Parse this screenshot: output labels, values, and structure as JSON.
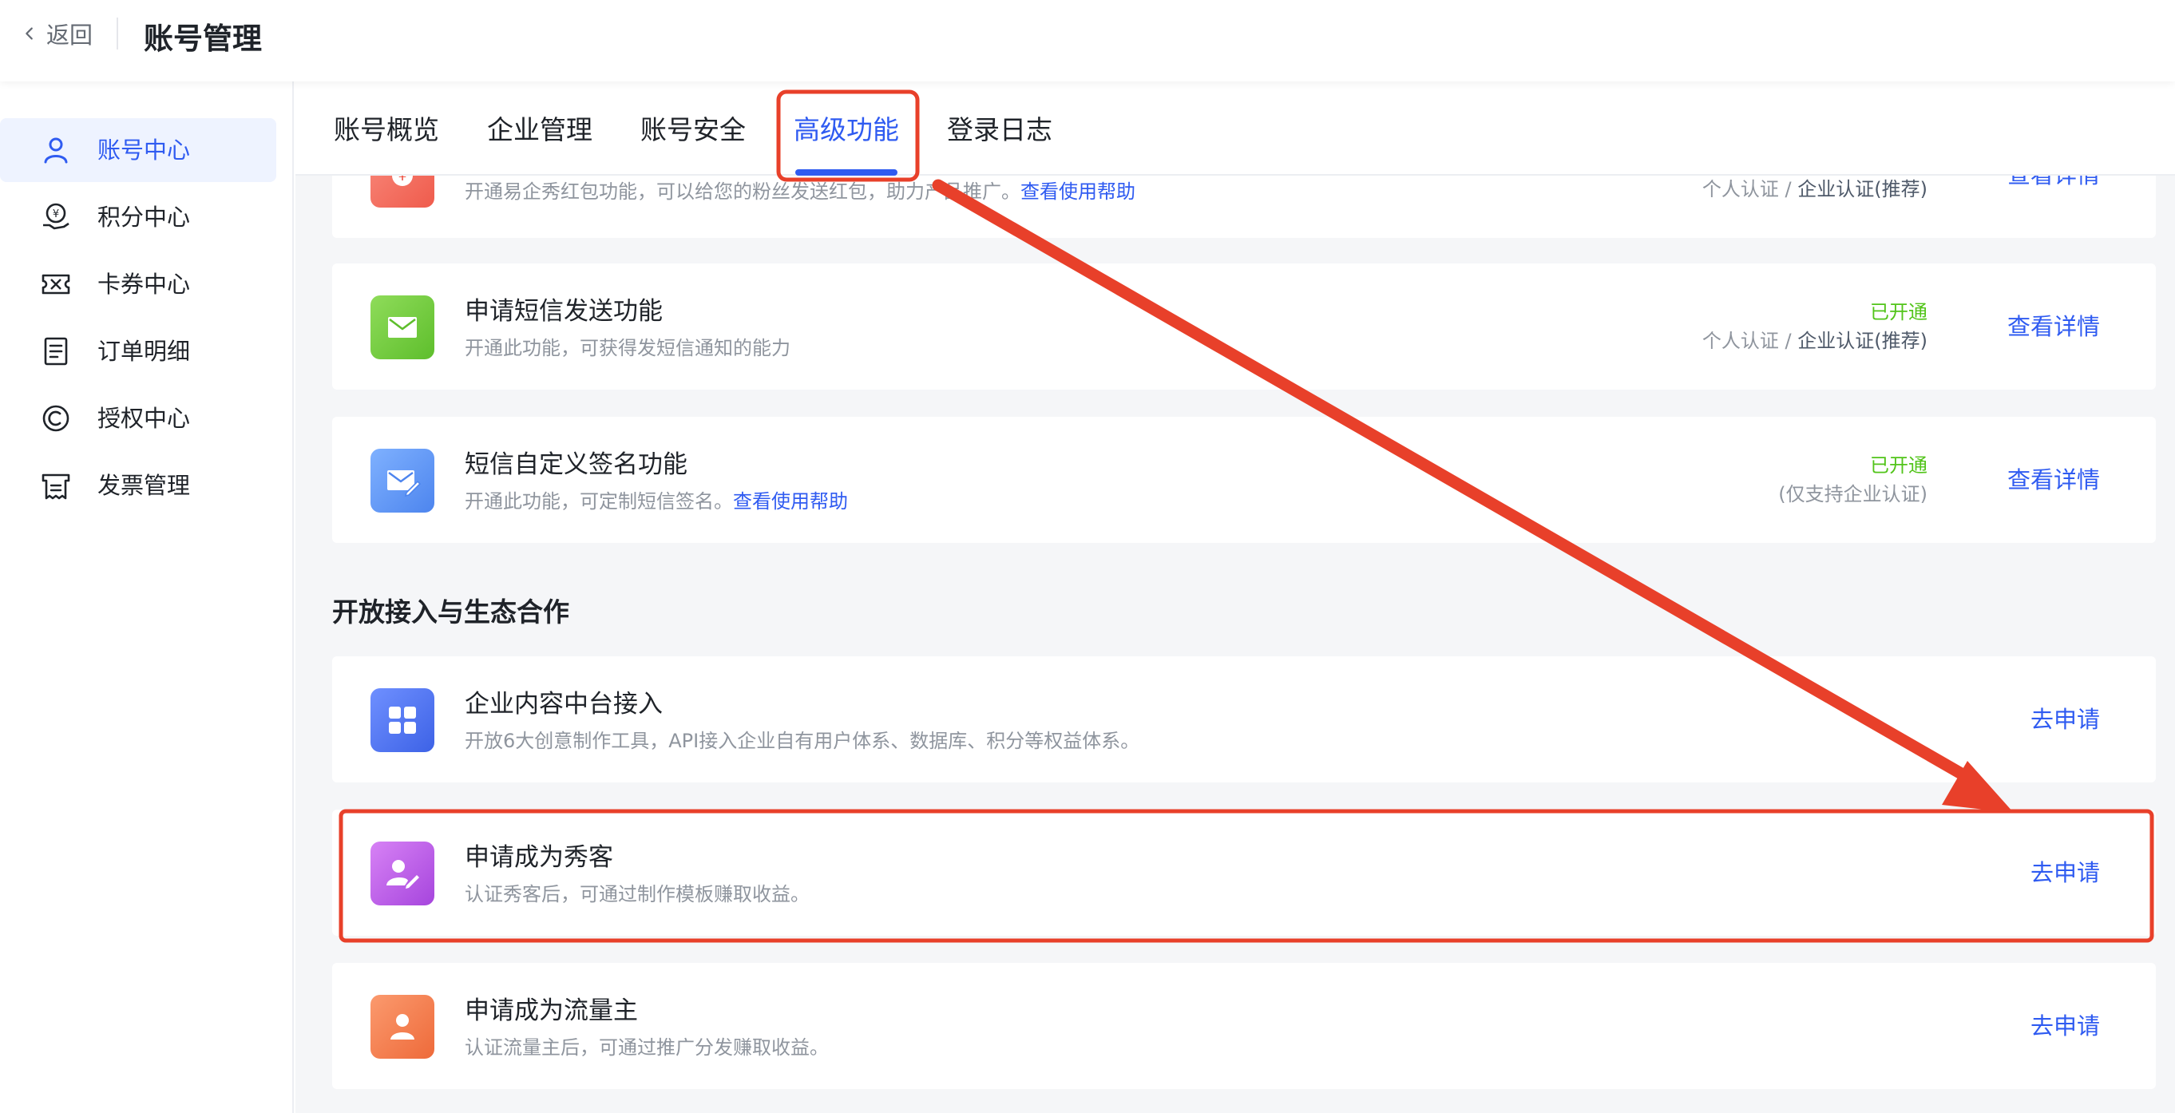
{
  "header": {
    "back_label": "返回",
    "title": "账号管理"
  },
  "sidebar": {
    "items": [
      {
        "label": "账号中心",
        "icon": "user-icon",
        "active": true
      },
      {
        "label": "积分中心",
        "icon": "points-icon",
        "active": false
      },
      {
        "label": "卡券中心",
        "icon": "ticket-icon",
        "active": false
      },
      {
        "label": "订单明细",
        "icon": "order-icon",
        "active": false
      },
      {
        "label": "授权中心",
        "icon": "copyright-icon",
        "active": false
      },
      {
        "label": "发票管理",
        "icon": "invoice-icon",
        "active": false
      }
    ]
  },
  "tabs": {
    "items": [
      {
        "label": "账号概览"
      },
      {
        "label": "企业管理"
      },
      {
        "label": "账号安全"
      },
      {
        "label": "高级功能",
        "active": true
      },
      {
        "label": "登录日志"
      }
    ]
  },
  "cards": {
    "red_packet": {
      "desc": "开通易企秀红包功能，可以给您的粉丝发送红包，助力产品推广。",
      "help": "查看使用帮助",
      "req_personal": "个人认证",
      "req_sep": "/",
      "req_enterprise": "企业认证(推荐)",
      "action": "查看详情"
    },
    "sms_send": {
      "title": "申请短信发送功能",
      "desc": "开通此功能，可获得发短信通知的能力",
      "status": "已开通",
      "req_personal": "个人认证",
      "req_sep": "/",
      "req_enterprise": "企业认证(推荐)",
      "action": "查看详情"
    },
    "sms_sign": {
      "title": "短信自定义签名功能",
      "desc": "开通此功能，可定制短信签名。",
      "help": "查看使用帮助",
      "status": "已开通",
      "req": "(仅支持企业认证)",
      "action": "查看详情"
    }
  },
  "section": {
    "title": "开放接入与生态合作"
  },
  "apply_cards": {
    "content_platform": {
      "title": "企业内容中台接入",
      "desc": "开放6大创意制作工具，API接入企业自有用户体系、数据库、积分等权益体系。",
      "action": "去申请"
    },
    "creator": {
      "title": "申请成为秀客",
      "desc": "认证秀客后，可通过制作模板赚取收益。",
      "action": "去申请"
    },
    "traffic": {
      "title": "申请成为流量主",
      "desc": "认证流量主后，可通过推广分发赚取收益。",
      "action": "去申请"
    }
  },
  "colors": {
    "accent": "#2f5bf1",
    "success": "#52c41a",
    "annotation": "#e8402a"
  }
}
